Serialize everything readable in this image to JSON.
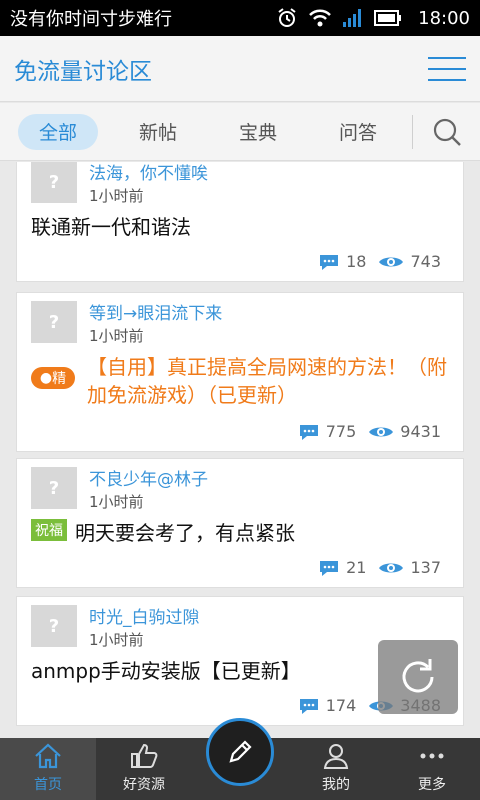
{
  "statusbar": {
    "title": "没有你时间寸步难行",
    "time": "18:00"
  },
  "header": {
    "title": "免流量讨论区"
  },
  "tabs": [
    {
      "label": "全部",
      "active": true
    },
    {
      "label": "新帖",
      "active": false
    },
    {
      "label": "宝典",
      "active": false
    },
    {
      "label": "问答",
      "active": false
    }
  ],
  "posts": [
    {
      "user": "法海，你不懂唉",
      "time": "1小时前",
      "title": "联通新一代和谐法",
      "comments": "18",
      "views": "743"
    },
    {
      "user": "等到→眼泪流下来",
      "time": "1小时前",
      "badge": "精",
      "title": "【自用】真正提高全局网速的方法！（附加免流游戏）（已更新）",
      "comments": "775",
      "views": "9431"
    },
    {
      "user": "不良少年@林子",
      "time": "1小时前",
      "badge": "祝福",
      "title": "明天要会考了，有点紧张",
      "comments": "21",
      "views": "137"
    },
    {
      "user": "时光_白驹过隙",
      "time": "1小时前",
      "title": "anmpp手动安装版【已更新】",
      "comments": "174",
      "views": "3488"
    }
  ],
  "bottomnav": [
    {
      "label": "首页",
      "icon": "home-icon",
      "active": true
    },
    {
      "label": "好资源",
      "icon": "thumbs-up-icon",
      "active": false
    },
    {
      "label": "",
      "icon": "pencil-icon",
      "active": false
    },
    {
      "label": "我的",
      "icon": "user-icon",
      "active": false
    },
    {
      "label": "更多",
      "icon": "more-icon",
      "active": false
    }
  ],
  "colors": {
    "accent": "#2a8bd6",
    "orange": "#f07b1a",
    "green": "#7bbe3b",
    "navbar": "#373737"
  }
}
